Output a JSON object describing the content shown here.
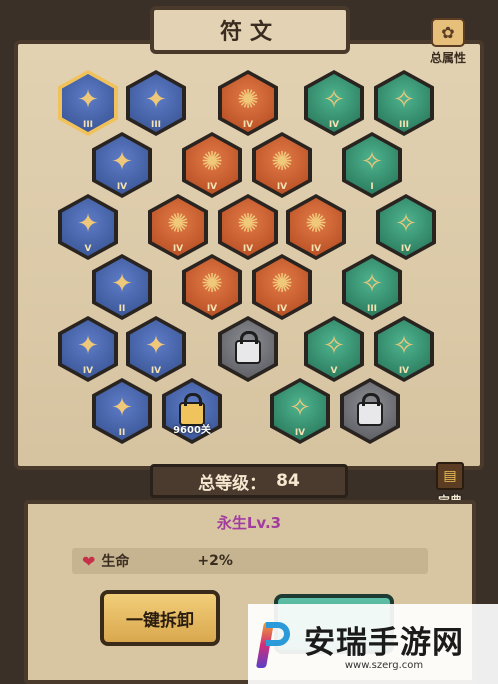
{
  "header": {
    "title": "符文",
    "total_attributes_label": "总属性"
  },
  "runes": [
    {
      "color": "blue",
      "rank": "III",
      "selected": true
    },
    {
      "color": "blue",
      "rank": "III",
      "selected": false
    },
    {
      "color": "red",
      "rank": "IV",
      "selected": false
    },
    {
      "color": "green",
      "rank": "IV",
      "selected": false
    },
    {
      "color": "green",
      "rank": "III",
      "selected": false
    },
    {
      "color": "blue",
      "rank": "IV",
      "selected": false
    },
    {
      "color": "red",
      "rank": "IV",
      "selected": false
    },
    {
      "color": "red",
      "rank": "IV",
      "selected": false
    },
    {
      "color": "green",
      "rank": "I",
      "selected": false
    },
    {
      "color": "blue",
      "rank": "V",
      "selected": false
    },
    {
      "color": "red",
      "rank": "IV",
      "selected": false
    },
    {
      "color": "red",
      "rank": "IV",
      "selected": false
    },
    {
      "color": "red",
      "rank": "IV",
      "selected": false
    },
    {
      "color": "green",
      "rank": "IV",
      "selected": false
    },
    {
      "color": "blue",
      "rank": "II",
      "selected": false
    },
    {
      "color": "red",
      "rank": "IV",
      "selected": false
    },
    {
      "color": "red",
      "rank": "IV",
      "selected": false
    },
    {
      "color": "green",
      "rank": "III",
      "selected": false
    },
    {
      "color": "blue",
      "rank": "IV",
      "selected": false
    },
    {
      "color": "blue",
      "rank": "IV",
      "selected": false
    },
    {
      "color": "gray",
      "rank": "",
      "locked": true
    },
    {
      "color": "green",
      "rank": "V",
      "selected": false
    },
    {
      "color": "green",
      "rank": "IV",
      "selected": false
    },
    {
      "color": "blue",
      "rank": "II",
      "selected": false
    },
    {
      "color": "blue",
      "rank": "",
      "locked": true,
      "requirement": "9600关"
    },
    {
      "color": "green",
      "rank": "IV",
      "selected": false
    },
    {
      "color": "gray",
      "rank": "",
      "locked": true
    }
  ],
  "level": {
    "label": "总等级：",
    "value": "84"
  },
  "codex_label": "宝典",
  "tier_name": "永生Lv.3",
  "stat": {
    "name": "生命",
    "value": "+2%"
  },
  "buttons": {
    "unload_all": "一键拆卸",
    "teal": ""
  },
  "watermark": {
    "title": "安瑞手游网",
    "url": "www.szerg.com"
  },
  "colors": {
    "blue": "#34508f",
    "red": "#b2481f",
    "green": "#237054",
    "gray": "#55565c",
    "selected": "#f2c25a",
    "tier": "#a23c9e"
  }
}
